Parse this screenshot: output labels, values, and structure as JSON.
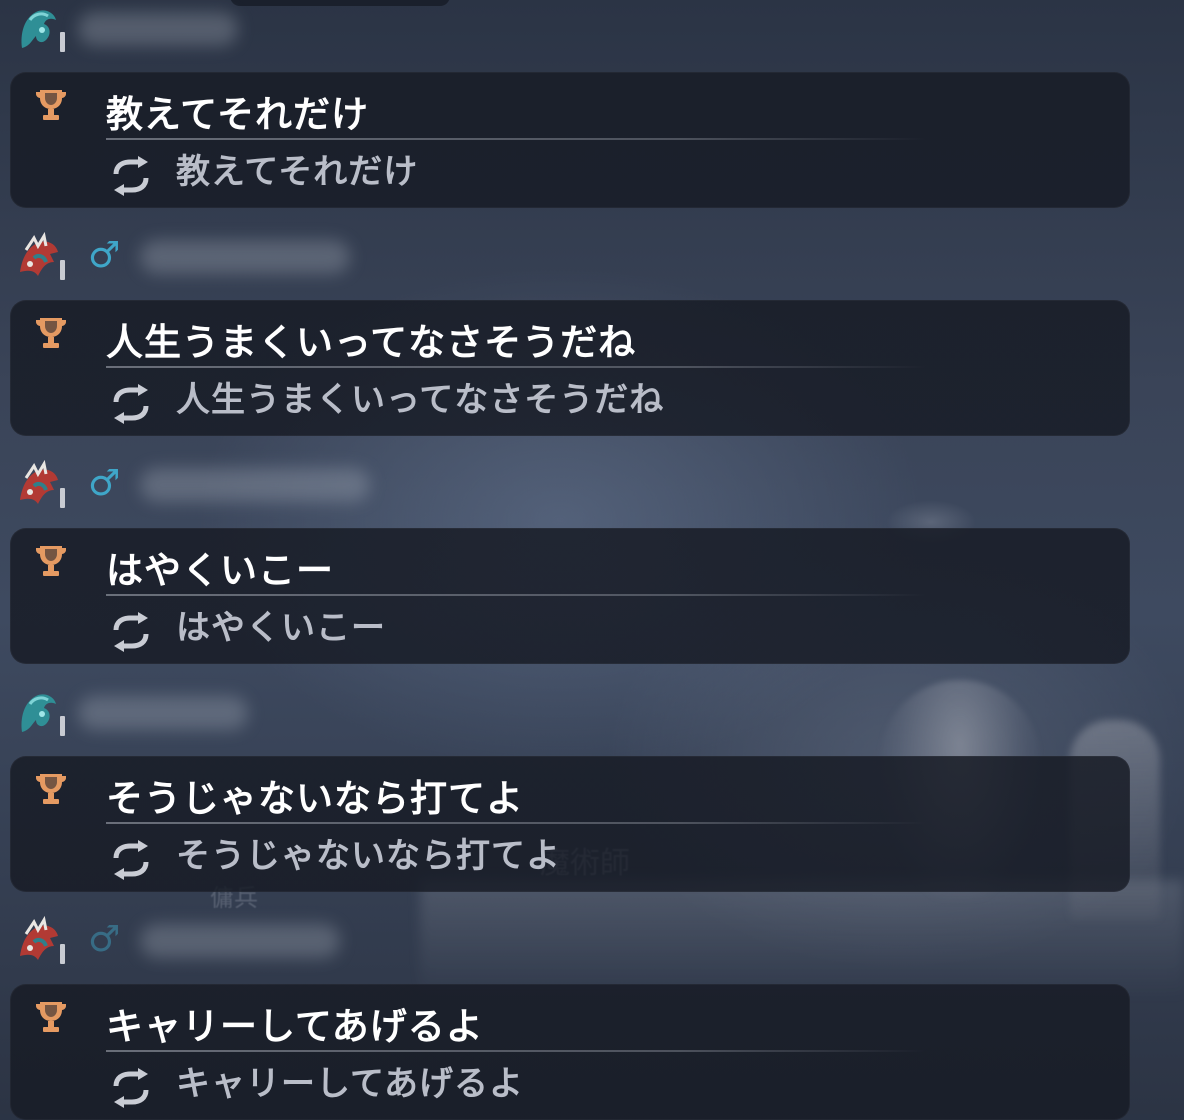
{
  "colors": {
    "bubble": "#181c26",
    "message_text": "#ffffff",
    "translation_text": "#b9bdc8",
    "trophy": "#e59a62",
    "gender_male": "#3fa6c8"
  },
  "messages": [
    {
      "avatar": "teal-character-icon",
      "show_gender": false,
      "gender_symbol": "",
      "badge": "trophy-icon",
      "text": "教えてそれだけ",
      "translation": "教えてそれだけ"
    },
    {
      "avatar": "red-character-icon",
      "show_gender": true,
      "gender_symbol": "♂",
      "badge": "trophy-icon",
      "text": "人生うまくいってなさそうだね",
      "translation": "人生うまくいってなさそうだね"
    },
    {
      "avatar": "red-character-icon",
      "show_gender": true,
      "gender_symbol": "♂",
      "badge": "trophy-icon",
      "text": "はやくいこー",
      "translation": "はやくいこー"
    },
    {
      "avatar": "teal-character-icon",
      "show_gender": false,
      "gender_symbol": "",
      "badge": "trophy-icon",
      "text": "そうじゃないなら打てよ",
      "translation": "そうじゃないなら打てよ"
    },
    {
      "avatar": "red-character-icon",
      "show_gender": true,
      "gender_symbol": "♂",
      "badge": "trophy-icon",
      "text": "キャリーしてあげるよ",
      "translation": "キャリーしてあげるよ"
    }
  ],
  "background": {
    "visible_text_1": "魔術師",
    "visible_text_2": "傭兵"
  }
}
